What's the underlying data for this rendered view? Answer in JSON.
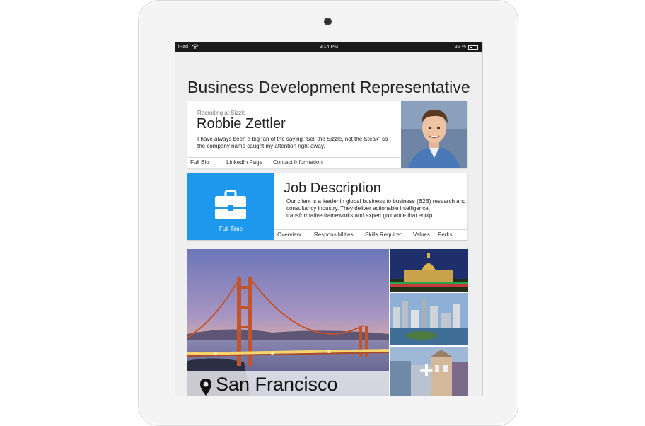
{
  "status_bar": {
    "device": "iPad",
    "time": "3:14 PM",
    "battery": "32 %",
    "battery_level": 0.32
  },
  "page_title": "Business Development Representative",
  "recruiter": {
    "subtitle": "Recruiting at Sizzle",
    "name": "Robbie Zettler",
    "quote": "I have always been a big fan of the saying \"Sell the Sizzle, not the Steak\" so the company name caught my attention right away.",
    "tabs": [
      "Full Bio",
      "LinkedIn Page",
      "Contact Information"
    ]
  },
  "job": {
    "type_label": "Full-Time",
    "title": "Job Description",
    "description": "Our client is a leader in global business to business (B2B) research and consultancy industry. They deliver actionable intelligence, transformative frameworks and expert guidance that equip...",
    "tabs": [
      "Overview",
      "Responsibilities",
      "Skills Required",
      "Values",
      "Perks"
    ]
  },
  "location": {
    "city": "San Francisco",
    "more_icon": "plus-icon",
    "pin_icon": "map-pin-icon"
  },
  "colors": {
    "accent_blue": "#1e98ec"
  }
}
